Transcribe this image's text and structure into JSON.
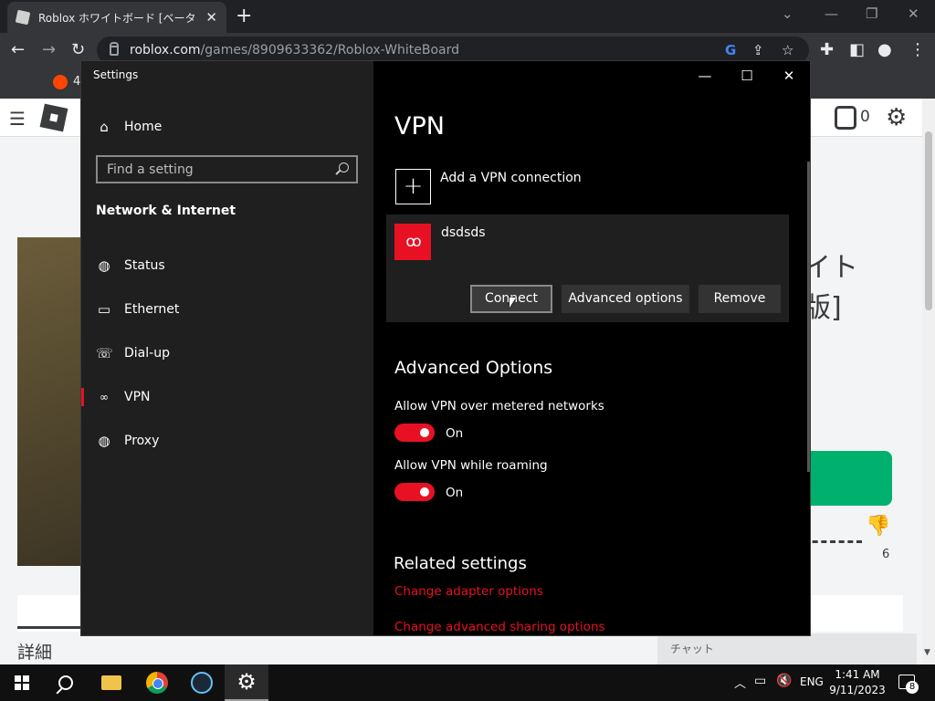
{
  "browser": {
    "tab_title": "Roblox ホワイトボード [ベータ版] - Ro",
    "url_host": "roblox.com",
    "url_path": "/games/8909633362/Roblox-WhiteBoard",
    "bookmark_label": "4"
  },
  "roblox": {
    "robux_count": "0",
    "title_line1": "イト",
    "title_line2": "版]",
    "dislike_count": "6",
    "detail_tab": "詳細",
    "chat_label": "チャット"
  },
  "settings": {
    "app_title": "Settings",
    "home_label": "Home",
    "search_placeholder": "Find a setting",
    "section_title": "Network & Internet",
    "nav_items": [
      {
        "label": "Status",
        "icon": "globe-icon"
      },
      {
        "label": "Ethernet",
        "icon": "monitor-icon"
      },
      {
        "label": "Dial-up",
        "icon": "dialup-icon"
      },
      {
        "label": "VPN",
        "icon": "vpn-icon"
      },
      {
        "label": "Proxy",
        "icon": "globe-icon"
      }
    ],
    "selected_nav": "VPN",
    "page_title": "VPN",
    "add_vpn_label": "Add a VPN connection",
    "vpn_connection": {
      "name": "dsdsds",
      "connect_label": "Connect",
      "advanced_label": "Advanced options",
      "remove_label": "Remove"
    },
    "advanced_heading": "Advanced Options",
    "options": [
      {
        "label": "Allow VPN over metered networks",
        "state": "On"
      },
      {
        "label": "Allow VPN while roaming",
        "state": "On"
      }
    ],
    "related_heading": "Related settings",
    "related_links": [
      "Change adapter options",
      "Change advanced sharing options"
    ],
    "accent_color": "#e81123"
  },
  "taskbar": {
    "language": "ENG",
    "time": "1:41 AM",
    "date": "9/11/2023",
    "notification_count": "8"
  }
}
